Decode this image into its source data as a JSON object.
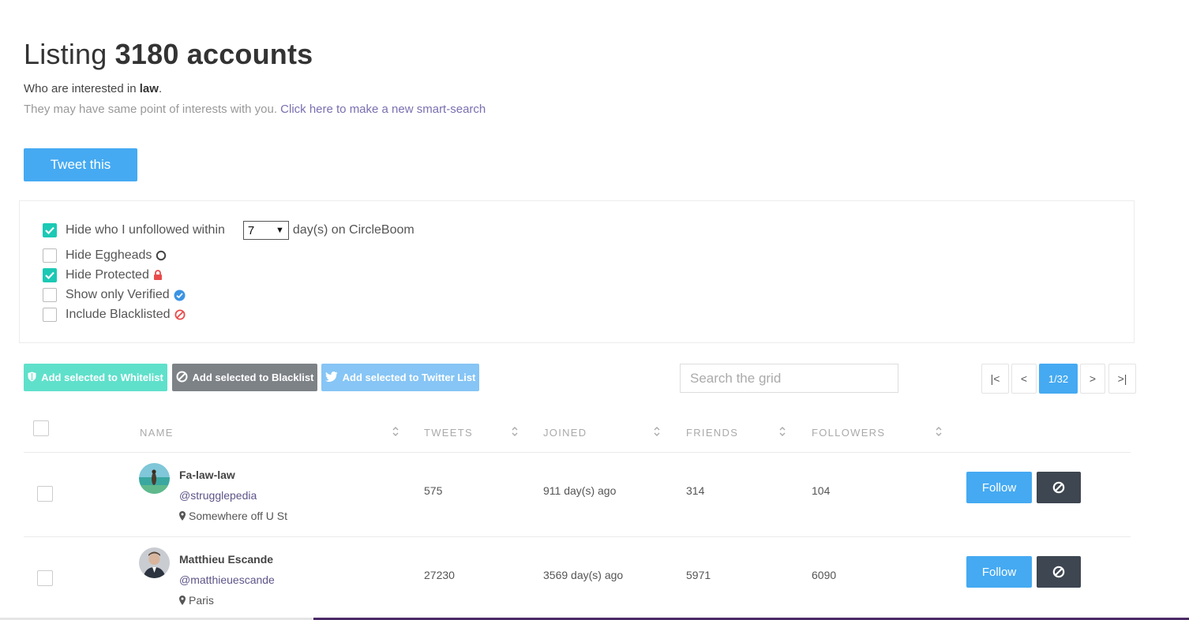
{
  "header": {
    "title_prefix": "Listing",
    "title_count": "3180 accounts",
    "interest_prefix": "Who are interested in",
    "interest_keyword": "law",
    "interest_suffix": ".",
    "subline_text": "They may have same point of interests with you.",
    "subline_link": "Click here to make a new smart-search"
  },
  "tweet_button": "Tweet this",
  "filters": {
    "unfollowed_label": "Hide who I unfollowed within",
    "unfollowed_checked": true,
    "days_value": "7",
    "days_suffix": "day(s) on CircleBoom",
    "eggheads_label": "Hide Eggheads",
    "eggheads_checked": false,
    "protected_label": "Hide Protected",
    "protected_checked": true,
    "verified_label": "Show only Verified",
    "verified_checked": false,
    "blacklisted_label": "Include Blacklisted",
    "blacklisted_checked": false
  },
  "actions": {
    "whitelist": "Add selected to Whitelist",
    "blacklist": "Add selected to Blacklist",
    "twitter_list": "Add selected to Twitter List"
  },
  "search": {
    "placeholder": "Search the grid"
  },
  "pagination": {
    "first": "|<",
    "prev": "<",
    "current": "1/32",
    "next": ">",
    "last": ">|"
  },
  "table": {
    "headers": {
      "name": "NAME",
      "tweets": "TWEETS",
      "joined": "JOINED",
      "friends": "FRIENDS",
      "followers": "FOLLOWERS"
    },
    "rows": [
      {
        "name": "Fa-law-law",
        "handle": "@strugglepedia",
        "location": "Somewhere off U St",
        "tweets": "575",
        "joined": "911 day(s) ago",
        "friends": "314",
        "followers": "104"
      },
      {
        "name": "Matthieu Escande",
        "handle": "@matthieuescande",
        "location": "Paris",
        "tweets": "27230",
        "joined": "3569 day(s) ago",
        "friends": "5971",
        "followers": "6090"
      }
    ],
    "follow_label": "Follow"
  },
  "colors": {
    "accent_blue": "#45aaf2",
    "checkbox_teal": "#1bc9b4",
    "whitelist_btn": "#5fe0cb",
    "blacklist_btn": "#7d8287",
    "twitter_list_btn": "#86c5f5",
    "block_btn": "#3d4651"
  }
}
